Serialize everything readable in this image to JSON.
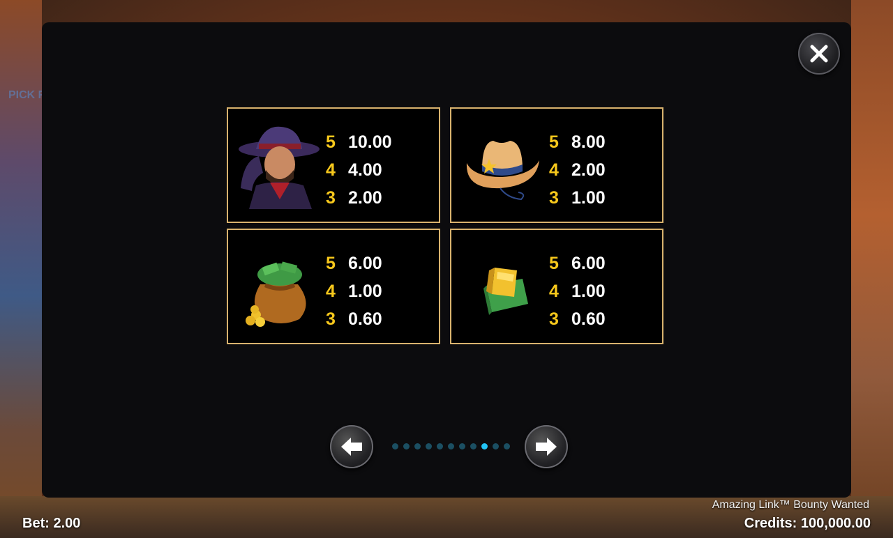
{
  "background": {
    "partial_text": "PICK F"
  },
  "paytable": {
    "cards": [
      {
        "symbol": "outlaw-cowboy-icon",
        "rows": [
          {
            "count": "5",
            "value": "10.00"
          },
          {
            "count": "4",
            "value": "4.00"
          },
          {
            "count": "3",
            "value": "2.00"
          }
        ]
      },
      {
        "symbol": "cowboy-hat-icon",
        "rows": [
          {
            "count": "5",
            "value": "8.00"
          },
          {
            "count": "4",
            "value": "2.00"
          },
          {
            "count": "3",
            "value": "1.00"
          }
        ]
      },
      {
        "symbol": "money-bag-icon",
        "rows": [
          {
            "count": "5",
            "value": "6.00"
          },
          {
            "count": "4",
            "value": "1.00"
          },
          {
            "count": "3",
            "value": "0.60"
          }
        ]
      },
      {
        "symbol": "gold-bar-cash-icon",
        "rows": [
          {
            "count": "5",
            "value": "6.00"
          },
          {
            "count": "4",
            "value": "1.00"
          },
          {
            "count": "3",
            "value": "0.60"
          }
        ]
      }
    ]
  },
  "pagination": {
    "total_pages": 11,
    "current_page": 9
  },
  "footer": {
    "game_title": "Amazing Link™ Bounty Wanted",
    "bet_label": "Bet: 2.00",
    "credits_label": "Credits: 100,000.00"
  },
  "colors": {
    "card_border": "#d9b36e",
    "count_color": "#f7c81c",
    "value_color": "#ffffff",
    "dot_active": "#22c4f5",
    "dot_inactive": "#1b4f62"
  }
}
